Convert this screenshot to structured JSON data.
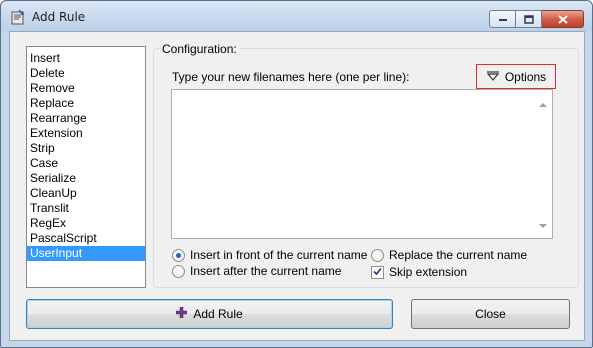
{
  "window": {
    "title": "Add Rule",
    "icon": "app-rule-icon",
    "controls": [
      "minimize-icon",
      "maximize-icon",
      "close-icon"
    ]
  },
  "rules": {
    "items": [
      "Insert",
      "Delete",
      "Remove",
      "Replace",
      "Rearrange",
      "Extension",
      "Strip",
      "Case",
      "Serialize",
      "CleanUp",
      "Translit",
      "RegEx",
      "PascalScript",
      "UserInput"
    ],
    "selected": "UserInput"
  },
  "config": {
    "legend": "Configuration:",
    "prompt": "Type your new filenames here (one per line):",
    "options_label": "Options",
    "options_icon": "triangle-down-icon",
    "names_value": "",
    "mode_insert_front": "Insert in front of the current name",
    "mode_insert_after": "Insert after the current name",
    "mode_replace": "Replace the current name",
    "skip_extension": "Skip extension",
    "selected_mode": "insert-front",
    "skip_extension_checked": true
  },
  "buttons": {
    "add_rule": "Add Rule",
    "add_icon": "plus-icon",
    "close": "Close"
  },
  "colors": {
    "selection": "#3399ff",
    "options_border": "#d9302b",
    "close_button": "#c0412a",
    "frame": "#c5d6ea"
  }
}
